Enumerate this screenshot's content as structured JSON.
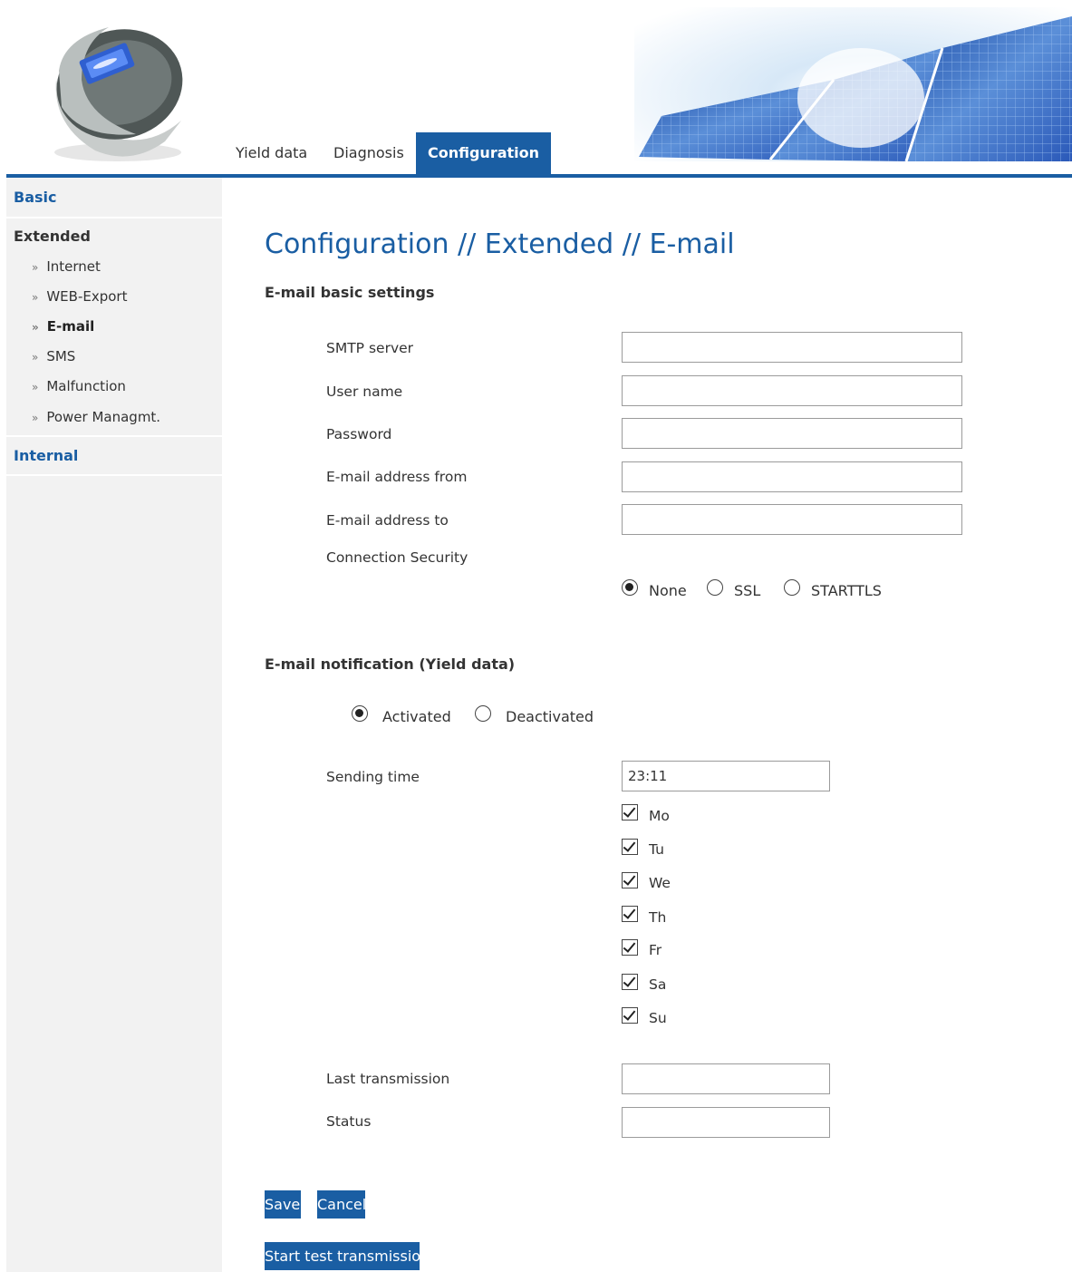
{
  "tabs": [
    {
      "label": "Yield data"
    },
    {
      "label": "Diagnosis"
    },
    {
      "label": "Configuration"
    }
  ],
  "sidebar": {
    "basic": "Basic",
    "extended": "Extended",
    "items": [
      {
        "label": "Internet"
      },
      {
        "label": "WEB-Export"
      },
      {
        "label": "E-mail"
      },
      {
        "label": "SMS"
      },
      {
        "label": "Malfunction"
      },
      {
        "label": "Power Managmt."
      }
    ],
    "internal": "Internal",
    "bullet": "»"
  },
  "page": {
    "title": "Configuration // Extended // E-mail"
  },
  "basic_settings": {
    "heading": "E-mail basic settings",
    "smtp_label": "SMTP server",
    "smtp_value": "",
    "user_label": "User name",
    "user_value": "",
    "password_label": "Password",
    "password_value": "",
    "from_label": "E-mail address from",
    "from_value": "",
    "to_label": "E-mail address to",
    "to_value": "",
    "security_label": "Connection Security",
    "security_options": [
      "None",
      "SSL",
      "STARTTLS"
    ],
    "security_selected": "None"
  },
  "notification": {
    "heading": "E-mail notification (Yield data)",
    "activated_label": "Activated",
    "deactivated_label": "Deactivated",
    "selected": "Activated",
    "sending_time_label": "Sending time",
    "sending_time_value": "23:11",
    "days": [
      {
        "label": "Mo",
        "checked": true
      },
      {
        "label": "Tu",
        "checked": true
      },
      {
        "label": "We",
        "checked": true
      },
      {
        "label": "Th",
        "checked": true
      },
      {
        "label": "Fr",
        "checked": true
      },
      {
        "label": "Sa",
        "checked": true
      },
      {
        "label": "Su",
        "checked": true
      }
    ],
    "last_transmission_label": "Last transmission",
    "last_transmission_value": "",
    "status_label": "Status",
    "status_value": ""
  },
  "buttons": {
    "save": "Save",
    "cancel": "Cancel",
    "test": "Start test transmission"
  },
  "colors": {
    "accent": "#1a5ea3",
    "sidebar_bg": "#f2f2f2"
  }
}
